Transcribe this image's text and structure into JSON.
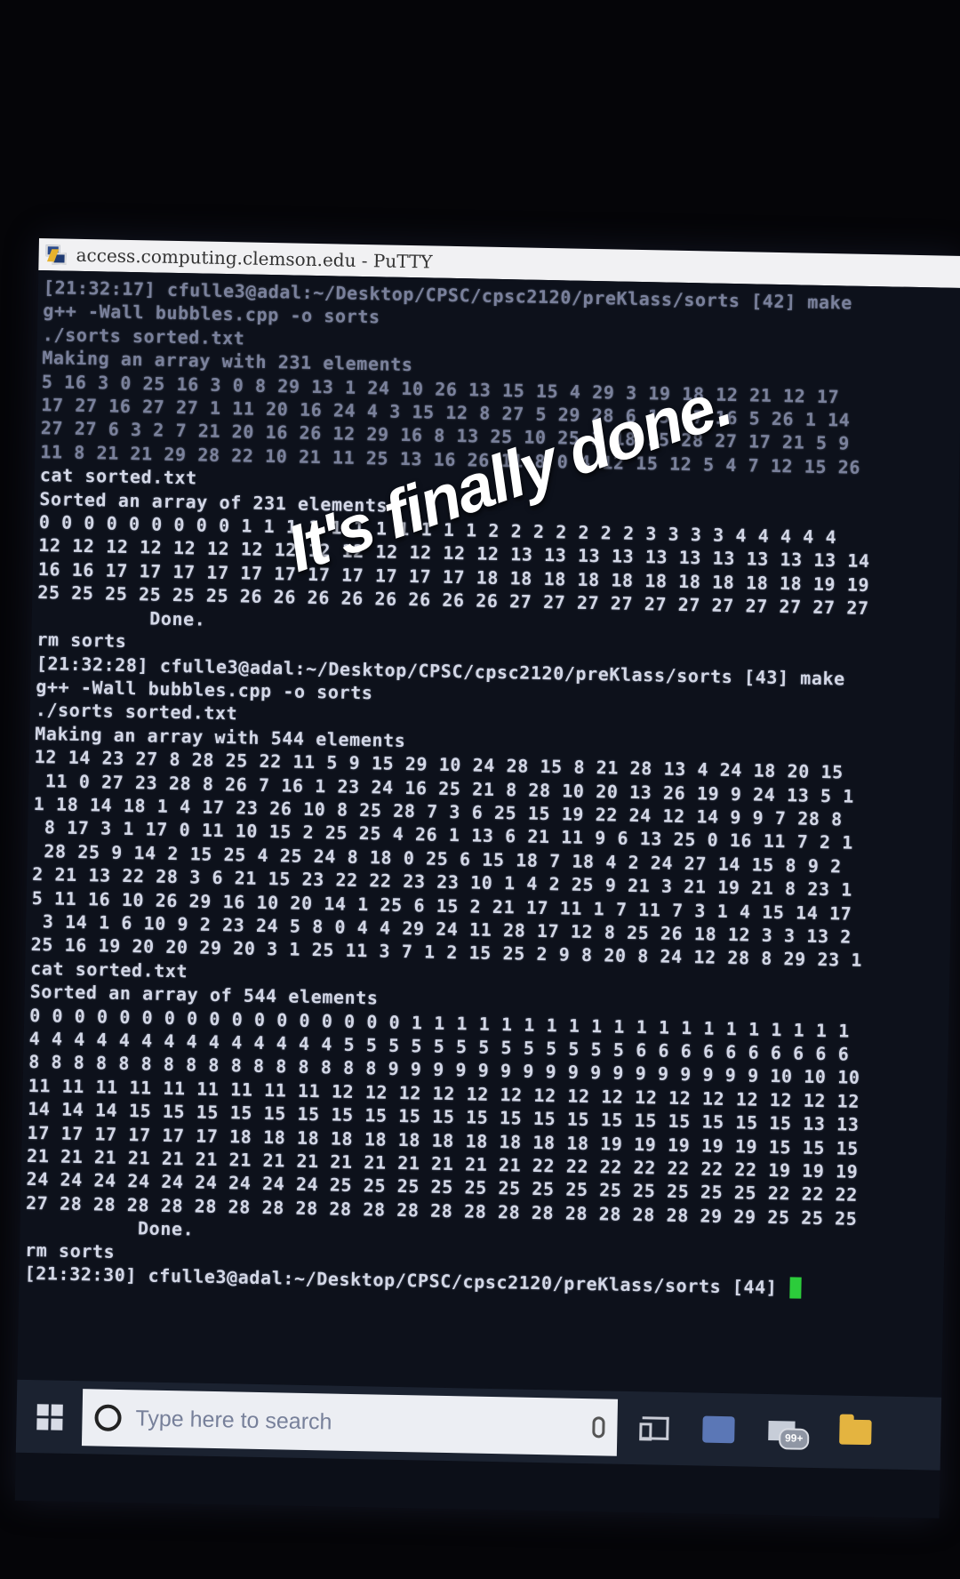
{
  "window": {
    "title": "access.computing.clemson.edu - PuTTY",
    "app": "PuTTY"
  },
  "terminal": {
    "lines": [
      "[21:32:17] cfulle3@adal:~/Desktop/CPSC/cpsc2120/preKlass/sorts [42] make",
      "g++ -Wall bubbles.cpp -o sorts",
      "./sorts sorted.txt",
      "Making an array with 231 elements",
      "5 16 3 0 25 16 3 0 8 29 13 1 24 10 26 13 15 15 4 29 3 19 18 12 21 12 17",
      "17 27 16 27 27 1 11 20 16 24 4 3 15 12 8 27 5 29 28 6 15 17 16 5 26 1 14",
      "27 27 6 3 2 7 21 20 16 26 12 29 16 8 13 25 10 25 3 18 15 28 27 17 21 5 9",
      "11 8 21 21 29 28 22 10 21 11 25 13 16 26 11 8 0 4 12 15 12 5 4 7 12 15 26",
      "cat sorted.txt",
      "Sorted an array of 231 elements",
      "0 0 0 0 0 0 0 0 0 1 1 1 1 1 1 1 1 1 1 1 2 2 2 2 2 2 2 3 3 3 3 4 4 4 4 4",
      "12 12 12 12 12 12 12 12 12 12 12 12 12 12 13 13 13 13 13 13 13 13 13 13 14",
      "16 16 17 17 17 17 17 17 17 17 17 17 17 18 18 18 18 18 18 18 18 18 18 19 19",
      "25 25 25 25 25 25 26 26 26 26 26 26 26 26 27 27 27 27 27 27 27 27 27 27 27",
      "          Done.",
      "rm sorts",
      "[21:32:28] cfulle3@adal:~/Desktop/CPSC/cpsc2120/preKlass/sorts [43] make",
      "g++ -Wall bubbles.cpp -o sorts",
      "./sorts sorted.txt",
      "Making an array with 544 elements",
      "12 14 23 27 8 28 25 22 11 5 9 15 29 10 24 28 15 8 21 28 13 4 24 18 20 15",
      " 11 0 27 23 28 8 26 7 16 1 23 24 16 25 21 8 28 10 20 13 26 19 9 24 13 5 1",
      "1 18 14 18 1 4 17 23 26 10 8 25 28 7 3 6 25 15 19 22 24 12 14 9 9 7 28 8",
      " 8 17 3 1 17 0 11 10 15 2 25 25 4 26 1 13 6 21 11 9 6 13 25 0 16 11 7 2 1",
      " 28 25 9 14 2 15 25 4 25 24 8 18 0 25 6 15 18 7 18 4 2 24 27 14 15 8 9 2",
      "2 21 13 22 28 3 6 21 15 23 22 22 23 23 10 1 4 2 25 9 21 3 21 19 21 8 23 1",
      "5 11 16 10 26 29 16 10 20 14 1 25 6 15 2 21 17 11 1 7 11 7 3 1 4 15 14 17",
      " 3 14 1 6 10 9 2 23 24 5 8 0 4 4 29 24 11 28 17 12 8 25 26 18 12 3 3 13 2",
      "25 16 19 20 20 29 20 3 1 25 11 3 7 1 2 15 25 2 9 8 20 8 24 12 28 8 29 23 1",
      "cat sorted.txt",
      "Sorted an array of 544 elements",
      "0 0 0 0 0 0 0 0 0 0 0 0 0 0 0 0 0 1 1 1 1 1 1 1 1 1 1 1 1 1 1 1 1 1 1 1 1",
      "4 4 4 4 4 4 4 4 4 4 4 4 4 4 5 5 5 5 5 5 5 5 5 5 5 5 5 6 6 6 6 6 6 6 6 6 6",
      "8 8 8 8 8 8 8 8 8 8 8 8 8 8 8 8 9 9 9 9 9 9 9 9 9 9 9 9 9 9 9 9 9 10 10 10",
      "11 11 11 11 11 11 11 11 11 12 12 12 12 12 12 12 12 12 12 12 12 12 12 12 12",
      "14 14 14 15 15 15 15 15 15 15 15 15 15 15 15 15 15 15 15 15 15 15 15 13 13",
      "17 17 17 17 17 17 18 18 18 18 18 18 18 18 18 18 18 19 19 19 19 19 15 15 15",
      "21 21 21 21 21 21 21 21 21 21 21 21 21 21 21 22 22 22 22 22 22 22 19 19 19",
      "24 24 24 24 24 24 24 24 24 25 25 25 25 25 25 25 25 25 25 25 25 25 22 22 22",
      "27 28 28 28 28 28 28 28 28 28 28 28 28 28 28 28 28 28 28 28 29 29 25 25 25",
      "          Done.",
      "rm sorts"
    ],
    "prompt": "[21:32:30] cfulle3@adal:~/Desktop/CPSC/cpsc2120/preKlass/sorts [44]"
  },
  "taskbar": {
    "search_placeholder": "Type here to search",
    "mail_badge": "99+"
  },
  "caption": "It's finally done.",
  "colors": {
    "terminal_bg": "#0d111b",
    "terminal_text": "#d3d7e6",
    "cursor": "#2ccc3b",
    "taskbar": "#1b2230"
  }
}
